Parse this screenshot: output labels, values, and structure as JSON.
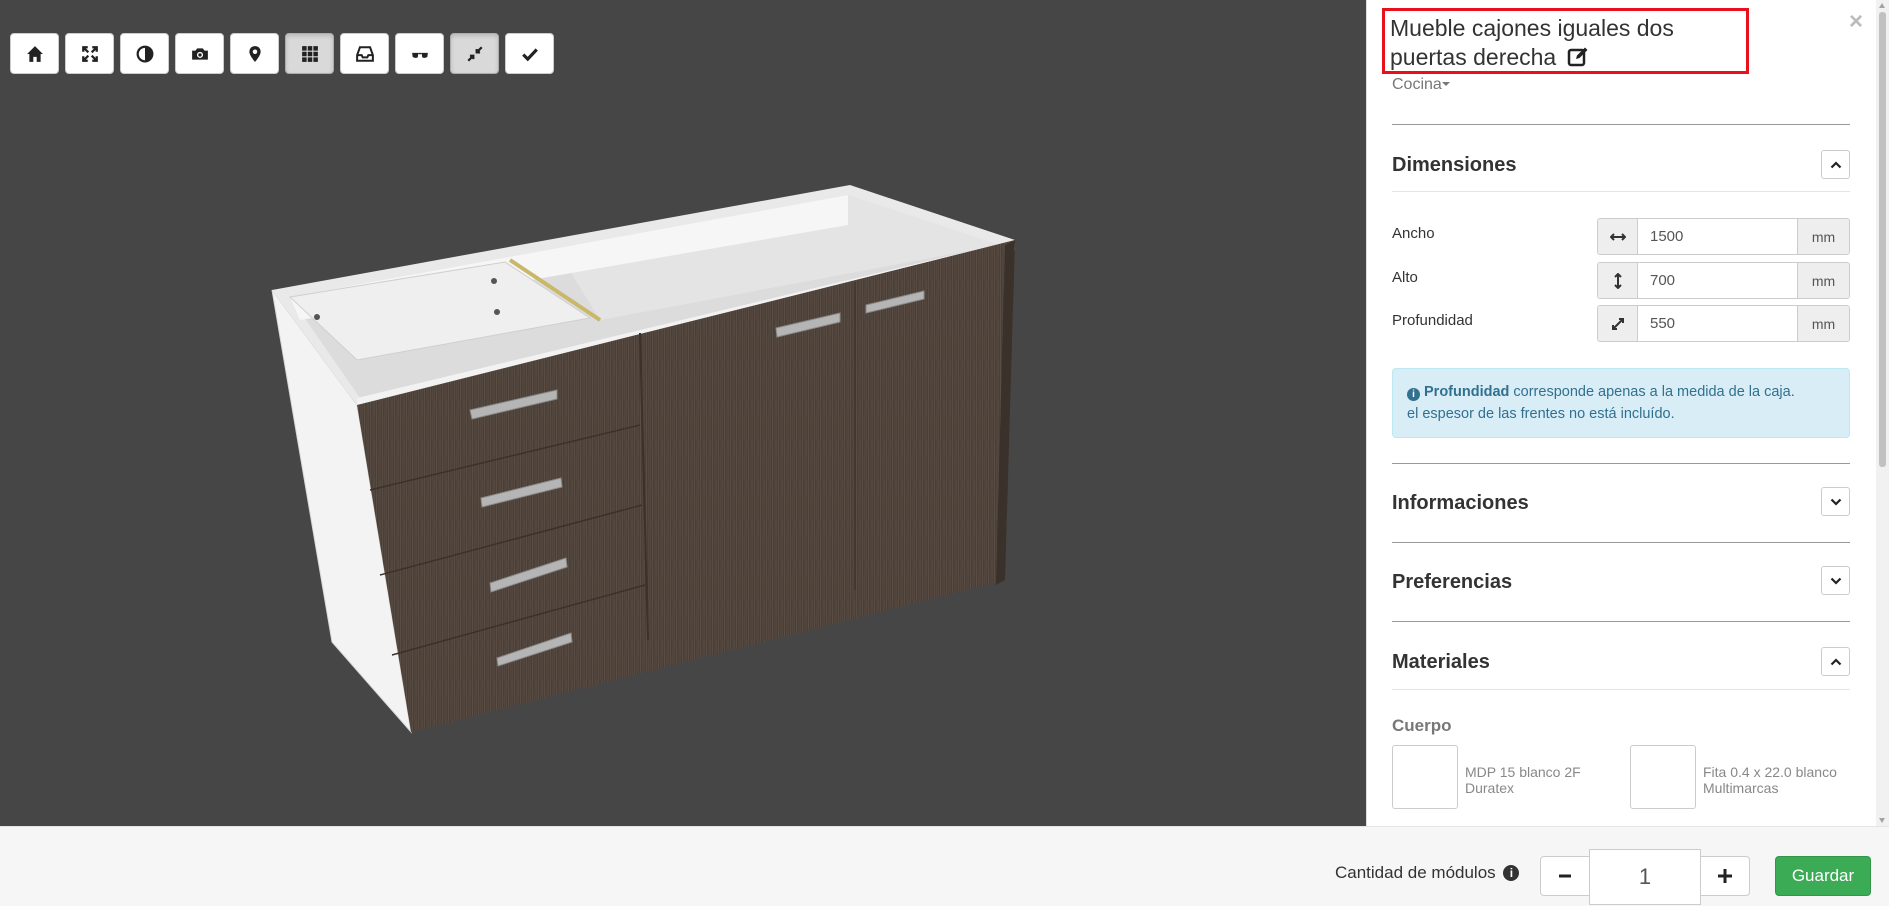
{
  "toolbar": {
    "buttons": [
      {
        "icon": "home-icon",
        "active": false
      },
      {
        "icon": "fullscreen-icon",
        "active": false
      },
      {
        "icon": "contrast-icon",
        "active": false
      },
      {
        "icon": "camera-icon",
        "active": false
      },
      {
        "icon": "map-marker-icon",
        "active": false
      },
      {
        "icon": "grid-icon",
        "active": true
      },
      {
        "icon": "inbox-icon",
        "active": false
      },
      {
        "icon": "glasses-icon",
        "active": false
      },
      {
        "icon": "compress-icon",
        "active": true
      },
      {
        "icon": "check-icon",
        "active": false
      }
    ]
  },
  "panel": {
    "title": "Mueble cajones iguales dos puertas derecha",
    "category": "Cocina",
    "close_label": "×",
    "sections": {
      "dimensiones": "Dimensiones",
      "informaciones": "Informaciones",
      "preferencias": "Preferencias",
      "materiales": "Materiales"
    },
    "dimensions": [
      {
        "label": "Ancho",
        "value": "1500",
        "unit": "mm",
        "icon": "arrows-horizontal-icon"
      },
      {
        "label": "Alto",
        "value": "700",
        "unit": "mm",
        "icon": "arrows-vertical-icon"
      },
      {
        "label": "Profundidad",
        "value": "550",
        "unit": "mm",
        "icon": "arrows-diagonal-icon"
      }
    ],
    "alert": {
      "bold": "Profundidad",
      "text1": " corresponde apenas a la medida de la caja.",
      "text2": "el espesor de las frentes no está incluído."
    },
    "materials": {
      "group": "Cuerpo",
      "items": [
        {
          "name": "MDP 15 blanco 2F Duratex"
        },
        {
          "name": "Fita 0.4 x 22.0 blanco Multimarcas"
        }
      ]
    }
  },
  "footer": {
    "quantity_label": "Cantidad de módulos",
    "quantity_value": "1",
    "save_label": "Guardar"
  },
  "colors": {
    "viewport_bg": "#464646",
    "highlight_red": "#e8101b",
    "save_green": "#3cab55",
    "alert_bg": "#d9edf7",
    "wood_dark": "#4a3f38"
  }
}
